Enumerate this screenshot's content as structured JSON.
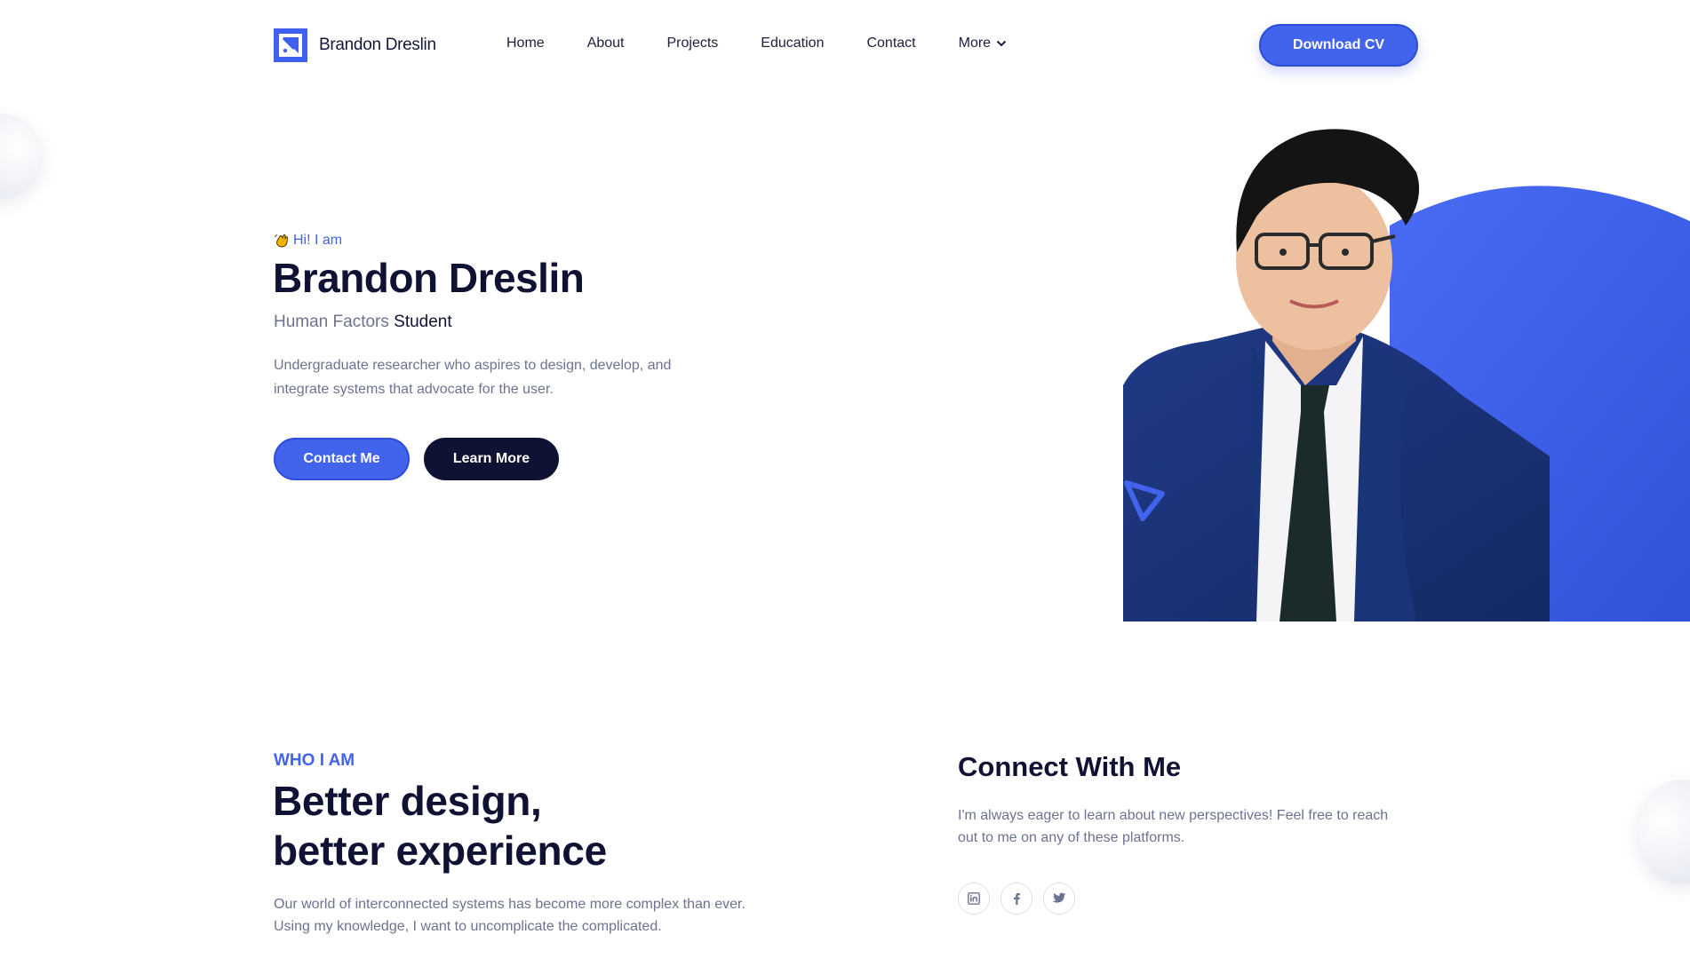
{
  "brand": {
    "name": "Brandon Dreslin"
  },
  "nav": {
    "items": [
      {
        "label": "Home"
      },
      {
        "label": "About"
      },
      {
        "label": "Projects"
      },
      {
        "label": "Education"
      },
      {
        "label": "Contact"
      },
      {
        "label": "More"
      }
    ]
  },
  "header": {
    "cta_label": "Download CV"
  },
  "hero": {
    "greeting_icon": "waving-hand-icon",
    "greeting": "Hi! I am",
    "name": "Brandon Dreslin",
    "role_muted": "Human Factors",
    "role_strong": "Student",
    "description": "Undergraduate researcher who aspires to design, develop, and integrate systems that advocate for the user.",
    "primary_button": "Contact Me",
    "secondary_button": "Learn More"
  },
  "about": {
    "eyebrow": "WHO I AM",
    "title_line1": "Better design,",
    "title_line2": "better experience",
    "description": "Our world of interconnected systems has become more complex than ever. Using my knowledge, I want to uncomplicate the complicated."
  },
  "connect": {
    "title": "Connect With Me",
    "description": "I'm always eager to learn about new perspectives! Feel free to reach out to me on any of these platforms.",
    "socials": [
      "linkedin-icon",
      "facebook-icon",
      "twitter-icon"
    ]
  },
  "colors": {
    "accent": "#4263eb",
    "dark": "#0f1233",
    "muted_text": "#6c7390"
  }
}
